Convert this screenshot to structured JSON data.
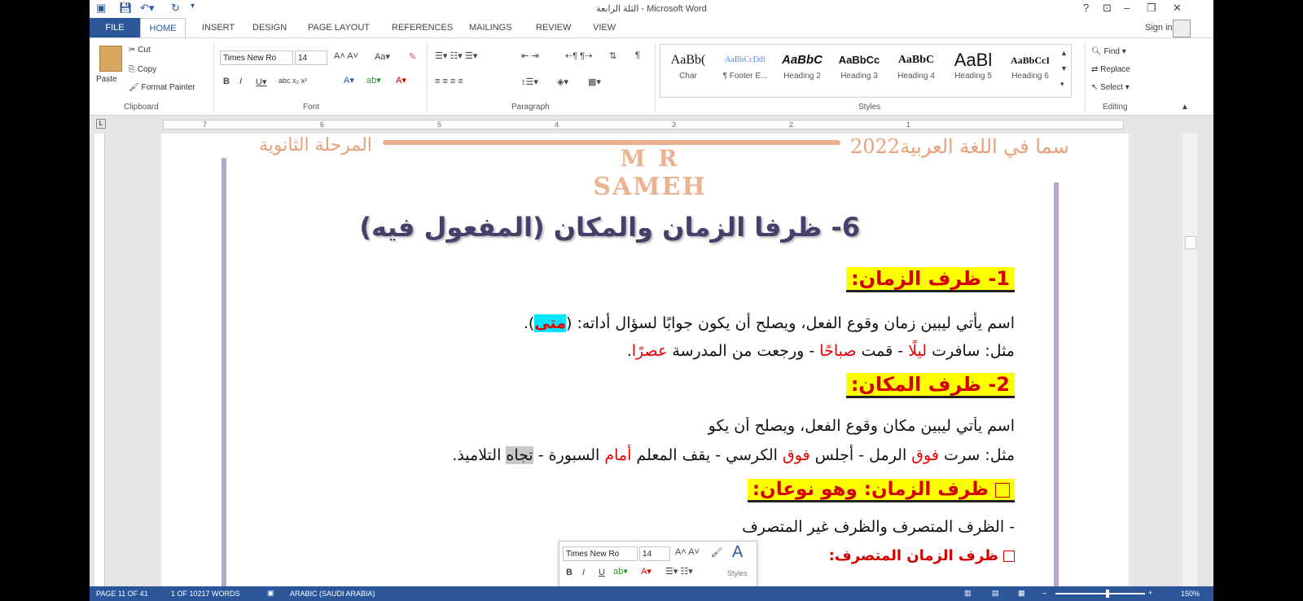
{
  "window": {
    "title": "الثلة الرابعة - Microsoft Word",
    "sign_in": "Sign in"
  },
  "tabs": [
    "FILE",
    "HOME",
    "INSERT",
    "DESIGN",
    "PAGE LAYOUT",
    "REFERENCES",
    "MAILINGS",
    "REVIEW",
    "VIEW"
  ],
  "clipboard": {
    "paste": "Paste",
    "cut": "Cut",
    "copy": "Copy",
    "format_painter": "Format Painter",
    "group": "Clipboard"
  },
  "font": {
    "name": "Times New Ro",
    "size": "14",
    "group": "Font"
  },
  "paragraph": {
    "group": "Paragraph"
  },
  "styles": {
    "group": "Styles",
    "items": [
      {
        "sample": "AaBb(",
        "name": "Char"
      },
      {
        "sample": "AaBbCcDdl",
        "name": "¶ Footer E..."
      },
      {
        "sample": "AaBbC",
        "name": "Heading 2"
      },
      {
        "sample": "AaBbCc",
        "name": "Heading 3"
      },
      {
        "sample": "AaBbC",
        "name": "Heading 4"
      },
      {
        "sample": "AaBl",
        "name": "Heading 5"
      },
      {
        "sample": "AaBbCcI",
        "name": "Heading 6"
      }
    ]
  },
  "editing": {
    "find": "Find",
    "replace": "Replace",
    "select": "Select",
    "group": "Editing"
  },
  "ruler": {
    "ticks": [
      "7",
      "6",
      "5",
      "4",
      "3",
      "2",
      "1"
    ]
  },
  "document": {
    "header_left": "المرحلة الثانوية",
    "header_right": "سما في اللغة العربية2022",
    "logo_line1": "M R",
    "logo_line2": "SAMEH",
    "title": "6- ظرفا الزمان والمكان (المفعول فيه)",
    "h1": "1- ظرف الزمان:",
    "p1a": "اسم يأتي ليبين زمان وقوع الفعل، ويصلح أن يكون جوابًا لسؤال أداته: (",
    "p1b": "متى",
    "p1c": ").",
    "ex1_prefix": "مثل: سافرت ",
    "ex1_w1": "ليلًا",
    "ex1_mid1": " - قمت ",
    "ex1_w2": "صباحًا",
    "ex1_mid2": " - ورجعت من المدرسة ",
    "ex1_w3": "عصرًا",
    "ex1_end": ".",
    "h2": "2- ظرف المكان:",
    "p2": "اسم يأتي ليبين مكان وقوع الفعل، ويصلح أن يكو",
    "ex2_prefix": "مثل: سرت ",
    "ex2_w1": "فوق",
    "ex2_mid1": " الرمل - أجلس ",
    "ex2_w2": "فوق",
    "ex2_mid2": " الكرسي - يقف المعلم ",
    "ex2_w3": "أمام",
    "ex2_mid3": " السبورة - ",
    "ex2_w4": "تجاه",
    "ex2_end": " التلاميذ.",
    "h3": "ظرف الزمان: وهو نوعان:",
    "p3": "- الظرف المتصرف والظرف غير المتصرف",
    "h4": "ظرف الزمان المتصرف:"
  },
  "mini_toolbar": {
    "font": "Times New Ro",
    "size": "14",
    "styles": "Styles"
  },
  "status": {
    "page": "PAGE 11 OF 41",
    "words": "1 OF 10217 WORDS",
    "language": "ARABIC (SAUDI ARABIA)",
    "zoom": "150%"
  }
}
